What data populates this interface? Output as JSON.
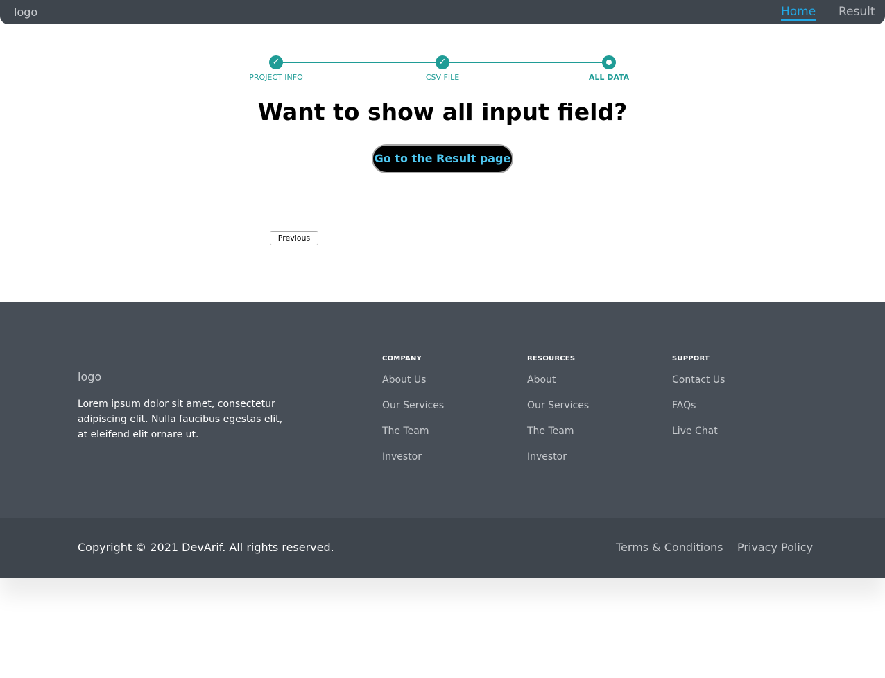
{
  "header": {
    "logo": "logo",
    "nav": {
      "home": "Home",
      "result": "Result"
    }
  },
  "stepper": {
    "steps": [
      {
        "label": "PROJECT INFO",
        "state": "completed",
        "icon": "✓"
      },
      {
        "label": "CSV FILE",
        "state": "completed",
        "icon": "✓"
      },
      {
        "label": "ALL DATA",
        "state": "current",
        "icon": ""
      }
    ],
    "accent_color": "#1f9c96"
  },
  "main": {
    "heading": "Want to show all input field?",
    "result_button": "Go to the Result page",
    "previous_button": "Previous"
  },
  "footer": {
    "logo": "logo",
    "description": "Lorem ipsum dolor sit amet, consectetur adipiscing elit. Nulla faucibus egestas elit, at eleifend elit ornare ut.",
    "columns": [
      {
        "title": "COMPANY",
        "links": [
          "About Us",
          "Our Services",
          "The Team",
          "Investor"
        ]
      },
      {
        "title": "RESOURCES",
        "links": [
          "About",
          "Our Services",
          "The Team",
          "Investor"
        ]
      },
      {
        "title": "SUPPORT",
        "links": [
          "Contact Us",
          "FAQs",
          "Live Chat"
        ]
      }
    ],
    "copyright": "Copyright © 2021 DevArif. All rights reserved.",
    "bottom_links": {
      "terms": "Terms & Conditions",
      "privacy": "Privacy Policy"
    }
  },
  "colors": {
    "header_bg": "#3e454d",
    "footer_bg": "#474e57",
    "nav_active": "#22a7e3",
    "button_text": "#4fc7f0"
  }
}
